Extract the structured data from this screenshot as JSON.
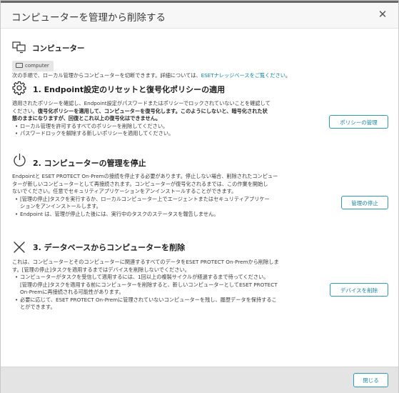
{
  "dialog": {
    "title": "コンピューターを管理から削除する",
    "close_icon": "close-icon"
  },
  "computer_section": {
    "icon": "computers-icon",
    "heading": "コンピューター",
    "chip_icon": "monitor-icon",
    "chip_label": "computer",
    "intro_text": "次の手順で、ローカル管理からコンピューターを切断できます。詳細については、",
    "intro_link": "ESETナレッジベースをご覧ください",
    "intro_end": "。"
  },
  "step1": {
    "icon": "gear-icon",
    "title": "1. Endpoint設定のリセットと復号化ポリシーの適用",
    "line1": "適用されたポリシーを確認し、Endpoint設定がパスワードまたはポリシーでロックされていないことを確認して",
    "line2a": "ください。",
    "line2b": "復号化ポリシーを適用して、コンピューターを復号化します。このようにしないと、暗号化された状",
    "line3": "態のままになりますが、回復とこれ以上の復号化はできません。",
    "bullets": [
      "ローカル管理を許可するすべてのポリシーを削除してください。",
      "パスワードロックを解除する新しいポリシーを適用してください。"
    ],
    "button": "ポリシーの管理"
  },
  "step2": {
    "icon": "power-icon",
    "title": "2. コンピューターの管理を停止",
    "line1": "Endpointと ESET PROTECT On-Premの接続を停止する必要があります。停止しない場合、削除されたコンピュー",
    "line2": "ターが新しいコンピューターとして再接続されます。コンピューターが復号化されるまでは、この作業を開始し",
    "line3": "ないでください。任意でセキュリティアプリケーションをアンインストールすることができます。",
    "bullet1_line1": "[管理の停止]タスクを実行するか、ローカルコンピューター上でエージェントまたはセキュリティアプリケー",
    "bullet1_line2": "ションをアンインストールします。",
    "bullet2": "Endpoint は、管理が停止した後には、実行中のタスクのステータスを報告しません。",
    "button": "管理の停止"
  },
  "step3": {
    "icon": "close-x-icon",
    "title": "3. データベースからコンピューターを削除",
    "line1": "これは、コンピューターとそのコンピューターに関連するすべてのデータをESET PROTECT On-Premから削除しま",
    "line2": "す。[管理の停止]タスクを適用するまではデバイスを削除しないでください。",
    "bullet1_line1": "コンピューターがタスクを受信して適用するには、1回以上の複製サイクルが経過するまで待ってください。",
    "bullet1_line2": "[管理の停止]タスクを適用する前にコンピューターを削除すると、新しいコンピューターとしてESET PROTECT",
    "bullet1_line3": "On-Premに再接続される可能性があります。",
    "bullet2_line1": "必要に応じて、ESET PROTECT On-Premに管理されていないコンピューターを残し、履歴データを保持するこ",
    "bullet2_line2": "とができます。",
    "button": "デバイスを削除"
  },
  "footer": {
    "close_button": "閉じる"
  }
}
